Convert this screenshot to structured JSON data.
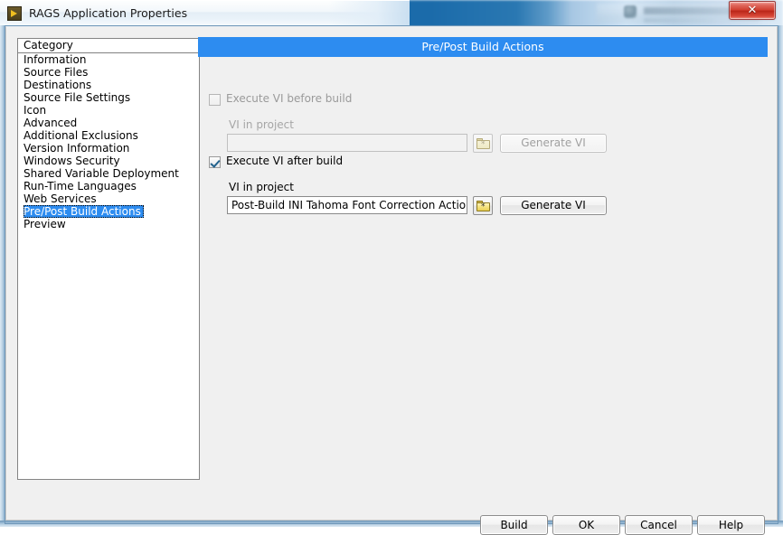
{
  "window": {
    "title": "RAGS Application Properties",
    "icon": "labview-vi-icon",
    "close_label": "✕"
  },
  "category_panel": {
    "header": "Category",
    "items": [
      {
        "label": "Information",
        "selected": false
      },
      {
        "label": "Source Files",
        "selected": false
      },
      {
        "label": "Destinations",
        "selected": false
      },
      {
        "label": "Source File Settings",
        "selected": false
      },
      {
        "label": "Icon",
        "selected": false
      },
      {
        "label": "Advanced",
        "selected": false
      },
      {
        "label": "Additional Exclusions",
        "selected": false
      },
      {
        "label": "Version Information",
        "selected": false
      },
      {
        "label": "Windows Security",
        "selected": false
      },
      {
        "label": "Shared Variable Deployment",
        "selected": false
      },
      {
        "label": "Run-Time Languages",
        "selected": false
      },
      {
        "label": "Web Services",
        "selected": false
      },
      {
        "label": "Pre/Post Build Actions",
        "selected": true
      },
      {
        "label": "Preview",
        "selected": false
      }
    ],
    "selected_label": "Pre/Post Build Actions"
  },
  "panel": {
    "title": "Pre/Post Build Actions",
    "title_bg": "#2d8cf0",
    "before": {
      "checkbox_label": "Execute VI before build",
      "checked": false,
      "enabled": false,
      "field_label": "VI in project",
      "field_value": "",
      "field_placeholder": "",
      "browse_icon": "folder-browse-icon",
      "generate_label": "Generate  VI"
    },
    "after": {
      "checkbox_label": "Execute VI after build",
      "checked": true,
      "enabled": true,
      "field_label": "VI in project",
      "field_value": "Post-Build INI Tahoma Font Correction Action.vi",
      "field_placeholder": "",
      "browse_icon": "folder-browse-icon",
      "generate_label": "Generate  VI"
    }
  },
  "footer": {
    "build_label": "Build",
    "ok_label": "OK",
    "cancel_label": "Cancel",
    "help_label": "Help"
  },
  "colors": {
    "accent": "#2d8cf0",
    "dialog_bg": "#f0f0f0",
    "list_bg": "#ffffff",
    "frame_glass": "#a8c3db",
    "close_red": "#cf3a2c"
  }
}
